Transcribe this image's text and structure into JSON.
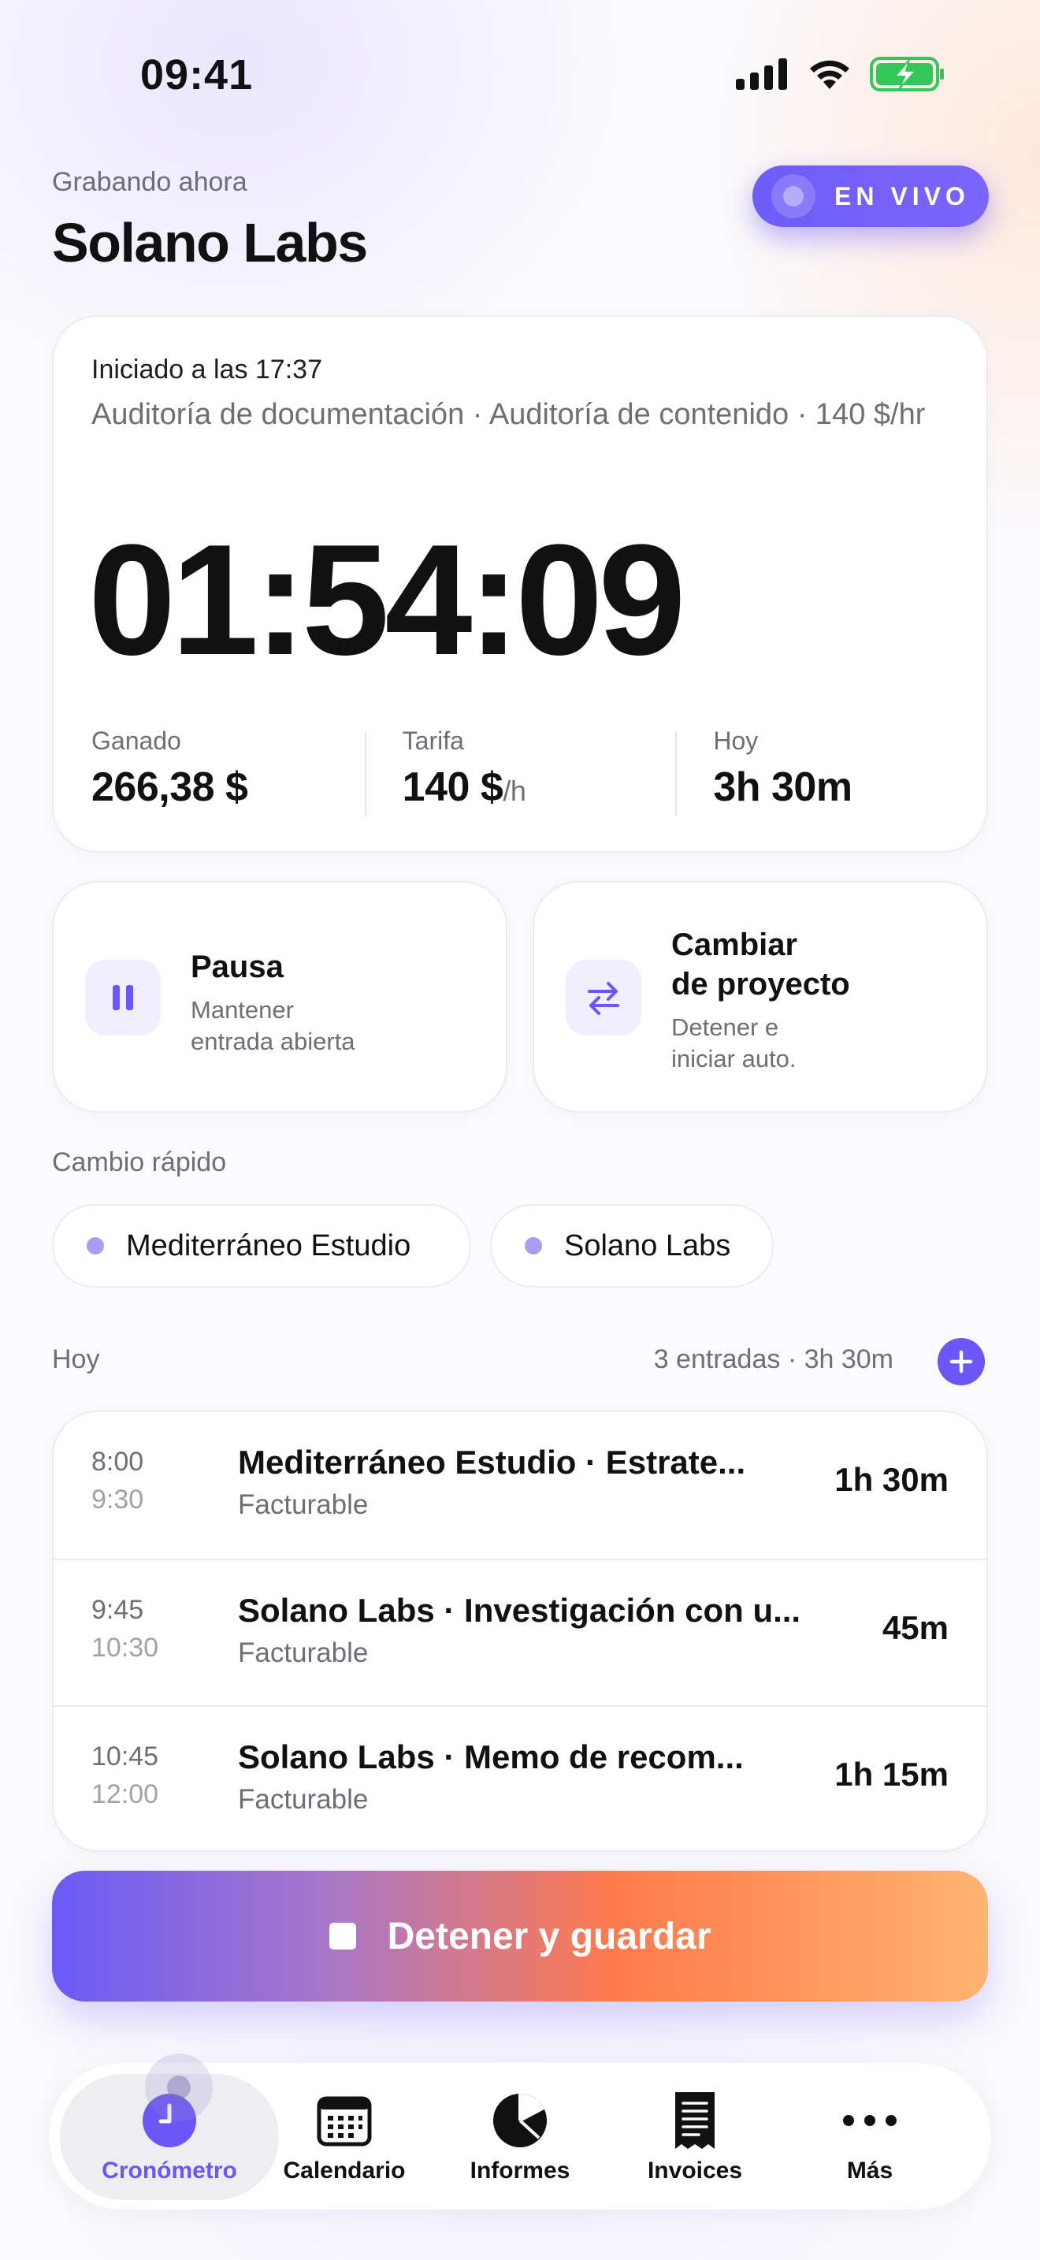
{
  "status_bar": {
    "time": "09:41"
  },
  "header": {
    "subtitle": "Grabando ahora",
    "title": "Solano Labs",
    "live_badge": "EN VIVO"
  },
  "timer": {
    "started": "Iniciado a las 17:37",
    "description": "Auditoría de documentación · Auditoría de contenido · 140 $/hr",
    "elapsed": "01:54:09",
    "stats": [
      {
        "label": "Ganado",
        "value": "266,38 $",
        "unit": ""
      },
      {
        "label": "Tarifa",
        "value": "140 $",
        "unit": "/h"
      },
      {
        "label": "Hoy",
        "value": "3h 30m",
        "unit": ""
      }
    ]
  },
  "actions": {
    "pause": {
      "title": "Pausa",
      "subtitle_line1": "Mantener",
      "subtitle_line2": "entrada abierta"
    },
    "switch": {
      "title_line1": "Cambiar",
      "title_line2": "de proyecto",
      "subtitle_line1": "Detener e",
      "subtitle_line2": "iniciar auto."
    }
  },
  "quick_switch": {
    "label": "Cambio rápido",
    "projects": [
      "Mediterráneo Estudio",
      "Solano Labs"
    ]
  },
  "today": {
    "label": "Hoy",
    "meta": "3 entradas · 3h 30m",
    "entries": [
      {
        "start": "8:00",
        "end": "9:30",
        "title": "Mediterráneo Estudio · Estrate...",
        "billing": "Facturable",
        "duration": "1h 30m"
      },
      {
        "start": "9:45",
        "end": "10:30",
        "title": "Solano Labs · Investigación con u...",
        "billing": "Facturable",
        "duration": "45m"
      },
      {
        "start": "10:45",
        "end": "12:00",
        "title": "Solano Labs · Memo de recom...",
        "billing": "Facturable",
        "duration": "1h 15m"
      }
    ]
  },
  "stop_button": {
    "label": "Detener y guardar"
  },
  "tabbar": {
    "tabs": [
      {
        "label": "Cronómetro",
        "icon": "clock-icon",
        "active": true
      },
      {
        "label": "Calendario",
        "icon": "calendar-icon",
        "active": false
      },
      {
        "label": "Informes",
        "icon": "pie-chart-icon",
        "active": false
      },
      {
        "label": "Invoices",
        "icon": "receipt-icon",
        "active": false
      },
      {
        "label": "Más",
        "icon": "more-icon",
        "active": false
      }
    ]
  },
  "colors": {
    "accent": "#6b57f5",
    "gradient_end": "#ffb471",
    "gradient_mid": "#ff7a4d",
    "battery": "#34c759"
  }
}
